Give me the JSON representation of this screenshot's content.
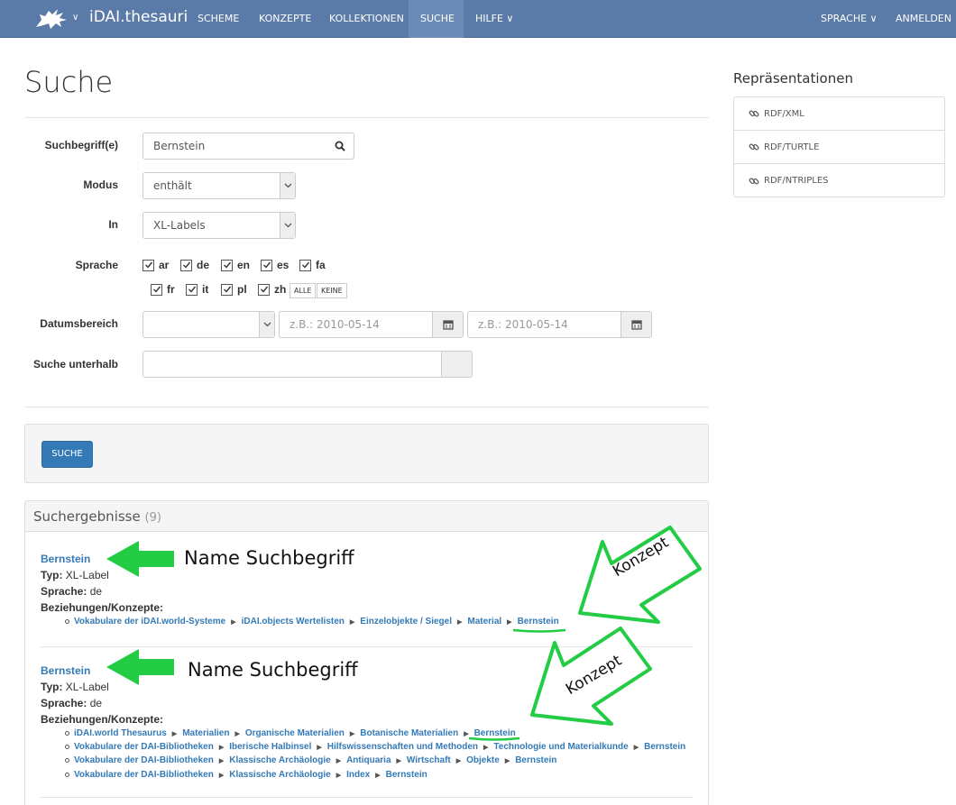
{
  "navbar": {
    "brand": "iDAI.thesauri",
    "items": [
      "SCHEME",
      "KONZEPTE",
      "KOLLEKTIONEN",
      "SUCHE",
      "HILFE"
    ],
    "active_item": "SUCHE",
    "right_items": [
      "SPRACHE",
      "ANMELDEN"
    ]
  },
  "page_title": "Suche",
  "form": {
    "search_label": "Suchbegriff(e)",
    "search_value": "Bernstein",
    "mode_label": "Modus",
    "mode_value": "enthält",
    "in_label": "In",
    "in_value": "XL-Labels",
    "language_label": "Sprache",
    "languages": [
      {
        "code": "ar",
        "checked": true
      },
      {
        "code": "de",
        "checked": true
      },
      {
        "code": "en",
        "checked": true
      },
      {
        "code": "es",
        "checked": true
      },
      {
        "code": "fa",
        "checked": true
      },
      {
        "code": "fr",
        "checked": true
      },
      {
        "code": "it",
        "checked": true
      },
      {
        "code": "pl",
        "checked": true
      },
      {
        "code": "zh",
        "checked": true
      }
    ],
    "all_button": "ALLE",
    "none_button": "KEINE",
    "date_label": "Datumsbereich",
    "date_from_placeholder": "z.B.: 2010-05-14",
    "date_to_placeholder": "z.B.: 2010-05-14",
    "below_label": "Suche unterhalb",
    "submit_label": "SUCHE"
  },
  "results": {
    "heading": "Suchergebnisse",
    "count": "(9)",
    "items": [
      {
        "title": "Bernstein",
        "typ_label": "Typ:",
        "typ": "XL-Label",
        "sprache_label": "Sprache:",
        "sprache": "de",
        "relations_label": "Beziehungen/Konzepte:",
        "paths": [
          [
            "Vokabulare der iDAI.world-Systeme",
            "iDAI.objects Wertelisten",
            "Einzelobjekte / Siegel",
            "Material",
            "Bernstein"
          ]
        ]
      },
      {
        "title": "Bernstein",
        "typ_label": "Typ:",
        "typ": "XL-Label",
        "sprache_label": "Sprache:",
        "sprache": "de",
        "relations_label": "Beziehungen/Konzepte:",
        "paths": [
          [
            "iDAI.world Thesaurus",
            "Materialien",
            "Organische Materialien",
            "Botanische Materialien",
            "Bernstein"
          ],
          [
            "Vokabulare der DAI-Bibliotheken",
            "Iberische Halbinsel",
            "Hilfswissenschaften und Methoden",
            "Technologie und Materialkunde",
            "Bernstein"
          ],
          [
            "Vokabulare der DAI-Bibliotheken",
            "Klassische Archäologie",
            "Antiquaria",
            "Wirtschaft",
            "Objekte",
            "Bernstein"
          ],
          [
            "Vokabulare der DAI-Bibliotheken",
            "Klassische Archäologie",
            "Index",
            "Bernstein"
          ]
        ]
      }
    ]
  },
  "sidebar": {
    "title": "Repräsentationen",
    "items": [
      "RDF/XML",
      "RDF/TURTLE",
      "RDF/NTRIPLES"
    ]
  },
  "annotations": {
    "name_label": "Name Suchbegriff",
    "concept_label": "Konzept",
    "color": "#22cc44"
  }
}
